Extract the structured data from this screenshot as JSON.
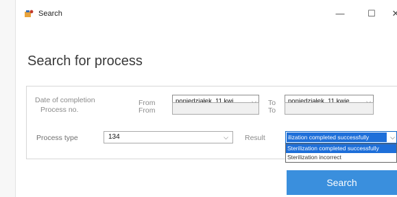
{
  "window": {
    "title": "Search",
    "minimize_glyph": "—",
    "maximize_glyph": "☐",
    "close_glyph": "✕"
  },
  "heading": "Search for process",
  "filters": {
    "date_of_completion": {
      "label": "Date of completion",
      "from_label": "From",
      "from_value": "poniedziałek, 11   kwi",
      "to_label": "To",
      "to_value": "poniedziałek, 11   kwie"
    },
    "process_no": {
      "label": "Process no.",
      "from_label": "From",
      "from_value": "",
      "to_label": "To",
      "to_value": ""
    },
    "process_type": {
      "label": "Process type",
      "value": "134"
    },
    "result": {
      "label": "Result",
      "selected": "ilization completed successfully",
      "options": [
        "Sterilization completed successfully",
        "Sterilization incorrect"
      ],
      "highlighted_index": 0
    }
  },
  "actions": {
    "search_label": "Search"
  },
  "colors": {
    "accent": "#3a8fdd",
    "selection": "#1e6fd9"
  },
  "icons": {
    "app": "search-app-icon",
    "dropdown": "chevron-down-icon"
  }
}
